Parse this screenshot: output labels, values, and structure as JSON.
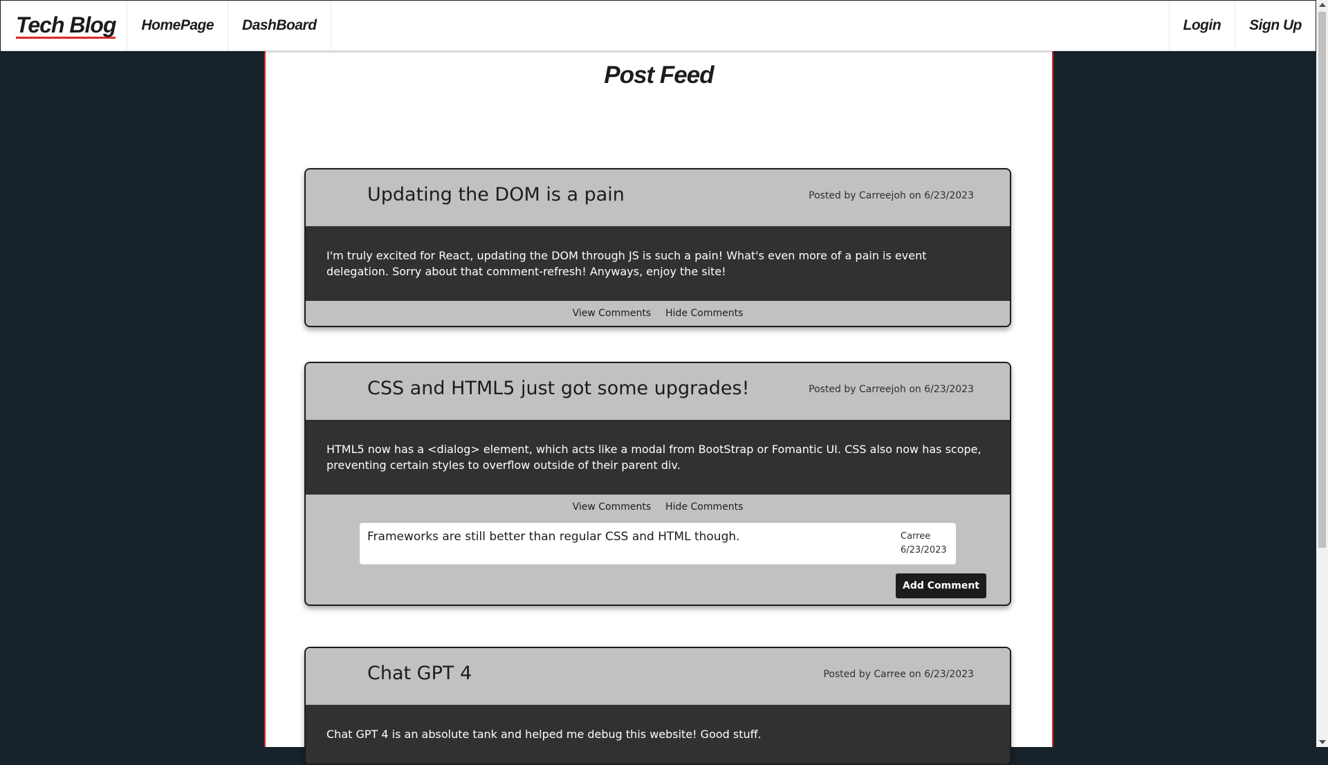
{
  "nav": {
    "brand": "Tech Blog",
    "homepage": "HomePage",
    "dashboard": "DashBoard",
    "login": "Login",
    "signup": "Sign Up"
  },
  "page": {
    "title": "Post Feed"
  },
  "posts": [
    {
      "title": "Updating the DOM is a pain",
      "meta": "Posted by Carreejoh on 6/23/2023",
      "body": "I'm truly excited for React, updating the DOM through JS is such a pain! What's even more of a pain is event delegation. Sorry about that comment-refresh! Anyways, enjoy the site!",
      "view_comments": "View Comments",
      "hide_comments": "Hide Comments"
    },
    {
      "title": "CSS and HTML5 just got some upgrades!",
      "meta": "Posted by Carreejoh on 6/23/2023",
      "body": "HTML5 now has a <dialog> element, which acts like a modal from BootStrap or Fomantic UI. CSS also now has scope, preventing certain styles to overflow outside of their parent div.",
      "view_comments": "View Comments",
      "hide_comments": "Hide Comments",
      "comments": [
        {
          "text": "Frameworks are still better than regular CSS and HTML though.",
          "author": "Carree",
          "date": "6/23/2023"
        }
      ],
      "add_comment": "Add Comment"
    },
    {
      "title": "Chat GPT 4",
      "meta": "Posted by Carree on 6/23/2023",
      "body": "Chat GPT 4 is an absolute tank and helped me debug this website! Good stuff."
    }
  ],
  "colors": {
    "background": "#17222a",
    "accent": "#db2828",
    "card": "#c2c1c2",
    "card_body": "#313131"
  }
}
